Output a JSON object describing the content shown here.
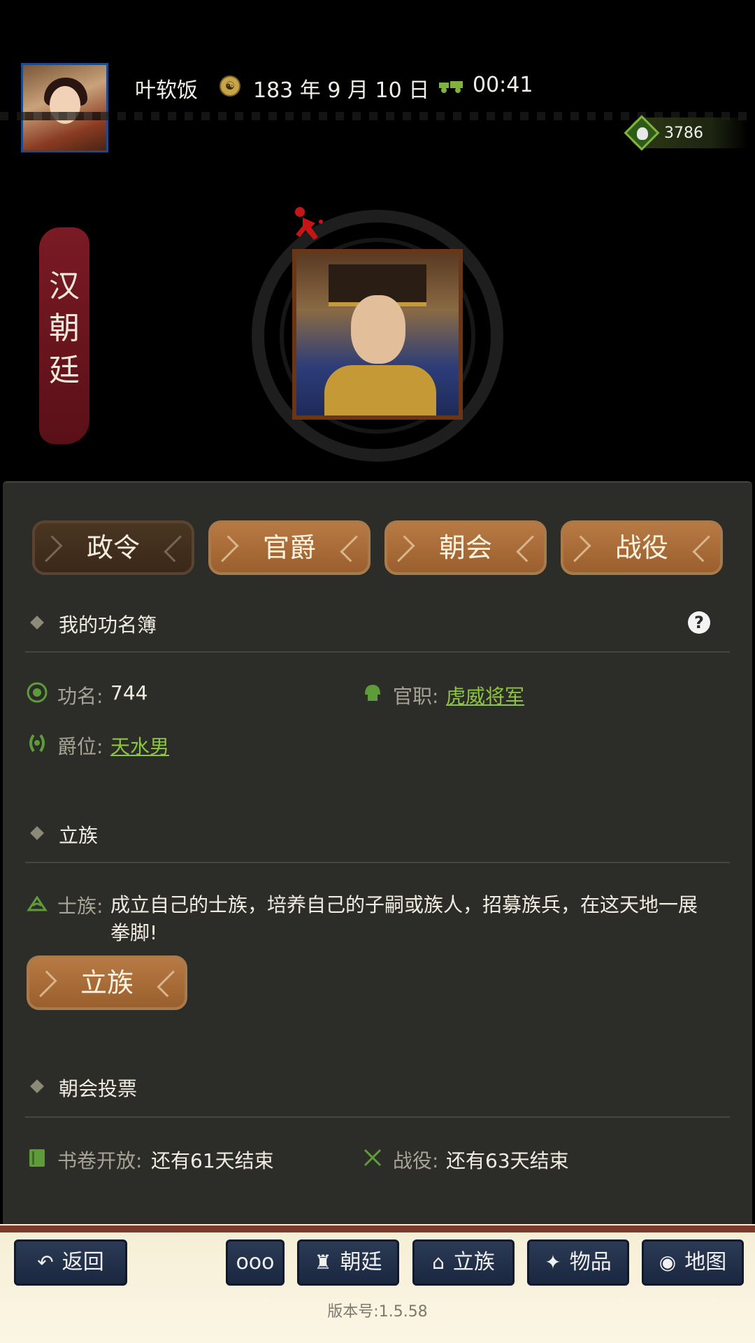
{
  "header": {
    "player_name": "叶软饭",
    "date": "183 年 9 月 10 日",
    "time": "00:41",
    "currency": "3786"
  },
  "court": {
    "banner": "汉朝廷"
  },
  "tabs": [
    {
      "label": "政令",
      "active": true
    },
    {
      "label": "官爵",
      "active": false
    },
    {
      "label": "朝会",
      "active": false
    },
    {
      "label": "战役",
      "active": false
    }
  ],
  "merit_book": {
    "title": "我的功名簿",
    "merit_label": "功名:",
    "merit_value": "744",
    "office_label": "官职:",
    "office_value": "虎威将军",
    "rank_label": "爵位:",
    "rank_value": "天水男"
  },
  "clan": {
    "title": "立族",
    "gentry_label": "士族:",
    "gentry_desc": "成立自己的士族，培养自己的子嗣或族人，招募族兵，在这天地一展拳脚!",
    "button": "立族"
  },
  "vote": {
    "title": "朝会投票",
    "scroll_label": "书卷开放:",
    "scroll_value": "还有61天结束",
    "battle_label": "战役:",
    "battle_value": "还有63天结束"
  },
  "nav": {
    "back": "返回",
    "more": "ooo",
    "court": "朝廷",
    "clan": "立族",
    "items": "物品",
    "map": "地图"
  },
  "version": "版本号:1.5.58",
  "colors": {
    "panel": "#2c2d28",
    "tab": "#9a5f2e",
    "tab_active": "#3a2818",
    "link": "#8cc63c",
    "nav_button": "#1b2740",
    "banner": "#6a1420"
  }
}
